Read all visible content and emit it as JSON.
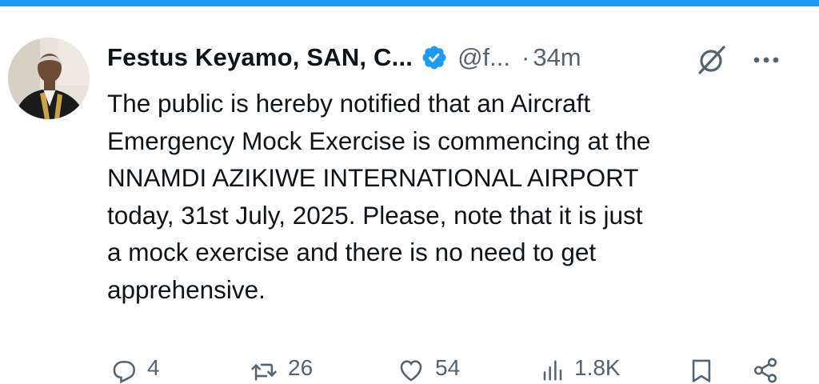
{
  "app": {
    "accent_color": "#1d9bf0",
    "secondary_text_color": "#536471"
  },
  "tweet": {
    "author": {
      "display_name": "Festus Keyamo, SAN, C...",
      "handle": "@f...",
      "verified": true,
      "avatar_icon": "profile-photo"
    },
    "separator": "·",
    "time": "34m",
    "lines": [
      "The public is hereby notified that an Aircraft",
      "Emergency Mock Exercise is commencing at the",
      "NNAMDI AZIKIWE INTERNATIONAL AIRPORT",
      "today, 31st July, 2025. Please, note that it is just",
      "a mock exercise and there is no need to get",
      "apprehensive."
    ],
    "actions": {
      "reply": {
        "icon": "reply-icon",
        "count": "4"
      },
      "repost": {
        "icon": "repost-icon",
        "count": "26"
      },
      "like": {
        "icon": "heart-icon",
        "count": "54"
      },
      "views": {
        "icon": "views-icon",
        "count": "1.8K"
      },
      "bookmark": {
        "icon": "bookmark-icon"
      },
      "share": {
        "icon": "share-icon"
      }
    }
  }
}
